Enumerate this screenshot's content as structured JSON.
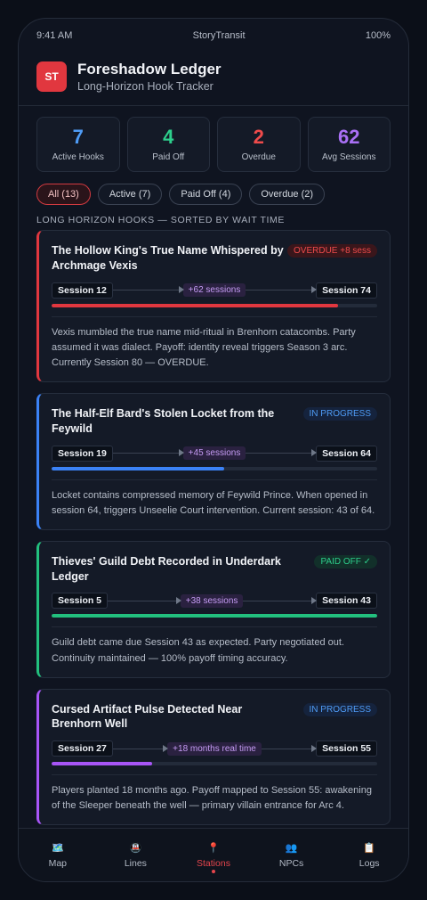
{
  "status_bar": {
    "time": "9:41 AM",
    "carrier": "StoryTransit",
    "battery": "100%"
  },
  "app": {
    "logo": "ST",
    "title": "Foreshadow Ledger",
    "subtitle": "Long-Horizon Hook Tracker"
  },
  "stats": [
    {
      "value": "7",
      "label": "Active Hooks",
      "color": "#4f9cf6"
    },
    {
      "value": "4",
      "label": "Paid Off",
      "color": "#2dcf8c"
    },
    {
      "value": "2",
      "label": "Overdue",
      "color": "#ef4b4b"
    },
    {
      "value": "62",
      "label": "Avg Sessions",
      "color": "#a970f5"
    }
  ],
  "filters": [
    {
      "label": "All (13)",
      "active": true
    },
    {
      "label": "Active (7)",
      "active": false
    },
    {
      "label": "Paid Off (4)",
      "active": false
    },
    {
      "label": "Overdue (2)",
      "active": false
    }
  ],
  "section_title": "LONG HORIZON HOOKS — SORTED BY WAIT TIME",
  "hooks": [
    {
      "title": "The Hollow King's True Name Whispered by Archmage Vexis",
      "badge": "OVERDUE +8 sess",
      "badge_color": "#ef4b4b",
      "badge_bg": "#3a161b",
      "accent": "#e1373f",
      "start": "Session 12",
      "gap": "+62 sessions",
      "end": "Session 74",
      "progress": 0.88,
      "description": "Vexis mumbled the true name mid-ritual in Brenhorn catacombs. Party assumed it was dialect. Payoff: identity reveal triggers Season 3 arc. Currently Session 80 — OVERDUE."
    },
    {
      "title": "The Half-Elf Bard's Stolen Locket from the Feywild",
      "badge": "IN PROGRESS",
      "badge_color": "#4f9cf6",
      "badge_bg": "#15233d",
      "accent": "#3b82f6",
      "start": "Session 19",
      "gap": "+45 sessions",
      "end": "Session 64",
      "progress": 0.53,
      "description": "Locket contains compressed memory of Feywild Prince. When opened in session 64, triggers Unseelie Court intervention. Current session: 43 of 64."
    },
    {
      "title": "Thieves' Guild Debt Recorded in Underdark Ledger",
      "badge": "PAID OFF ✓",
      "badge_color": "#2dcf8c",
      "badge_bg": "#12302a",
      "accent": "#22c07e",
      "start": "Session 5",
      "gap": "+38 sessions",
      "end": "Session 43",
      "progress": 1.0,
      "description": "Guild debt came due Session 43 as expected. Party negotiated out. Continuity maintained — 100% payoff timing accuracy."
    },
    {
      "title": "Cursed Artifact Pulse Detected Near Brenhorn Well",
      "badge": "IN PROGRESS",
      "badge_color": "#4f9cf6",
      "badge_bg": "#15233d",
      "accent": "#a855f7",
      "start": "Session 27",
      "gap": "+18 months real time",
      "end": "Session 55",
      "progress": 0.31,
      "description": "Players planted 18 months ago. Payoff mapped to Session 55: awakening of the Sleeper beneath the well — primary villain entrance for Arc 4."
    }
  ],
  "nav": [
    {
      "icon": "🗺️",
      "icon_name": "map-icon",
      "label": "Map",
      "active": false
    },
    {
      "icon": "🚇",
      "icon_name": "metro-icon",
      "label": "Lines",
      "active": false
    },
    {
      "icon": "📍",
      "icon_name": "pin-icon",
      "label": "Stations",
      "active": true
    },
    {
      "icon": "👥",
      "icon_name": "people-icon",
      "label": "NPCs",
      "active": false
    },
    {
      "icon": "📋",
      "icon_name": "clipboard-icon",
      "label": "Logs",
      "active": false
    }
  ]
}
